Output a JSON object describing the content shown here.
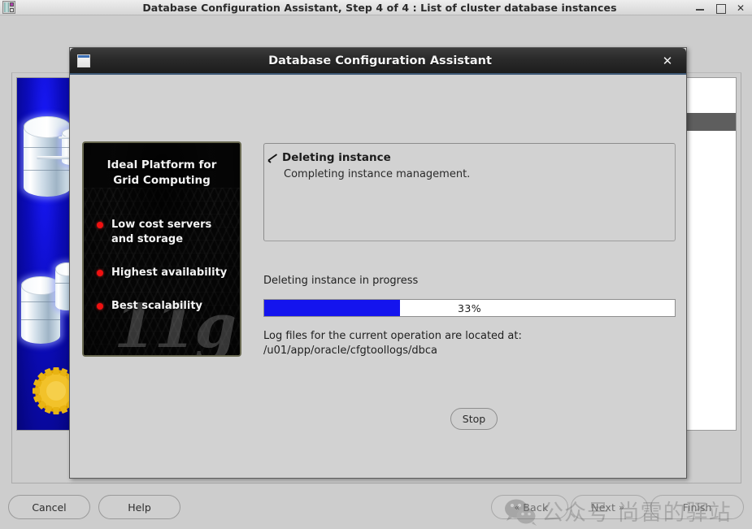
{
  "outer_window": {
    "title": "Database Configuration Assistant, Step 4 of 4 : List of cluster database instances",
    "app_icon": "database-app-icon",
    "controls": {
      "minimize": "minimize-icon",
      "maximize": "maximize-icon",
      "close": "✕"
    }
  },
  "outer_buttons": {
    "cancel": "Cancel",
    "help": "Help",
    "back_arrow": "«",
    "back": "Back",
    "next": "Next",
    "next_arrow": "»",
    "finish": "Finish"
  },
  "watermark": {
    "text": "公众号  尚雷的驿站",
    "logo": "wechat-logo"
  },
  "dialog": {
    "title": "Database Configuration Assistant",
    "icon": "window-app-icon",
    "close": "✕",
    "promo": {
      "headline": "Ideal Platform for\nGrid Computing",
      "headline_line1": "Ideal Platform for",
      "headline_line2": "Grid Computing",
      "version_watermark": "11g",
      "bullets": [
        "Low cost servers\nand storage",
        "Highest availability",
        "Best scalability"
      ]
    },
    "status": {
      "check_icon": "checkmark-icon",
      "title": "Deleting instance",
      "subtitle": "Completing instance management."
    },
    "progress": {
      "label": "Deleting instance in progress",
      "percent": 33,
      "percent_text": "33%",
      "fill_color": "#1414ee"
    },
    "log": {
      "line1": "Log files for the current operation are located at:",
      "line2": "/u01/app/oracle/cfgtoollogs/dbca"
    },
    "stop_button": "Stop"
  }
}
